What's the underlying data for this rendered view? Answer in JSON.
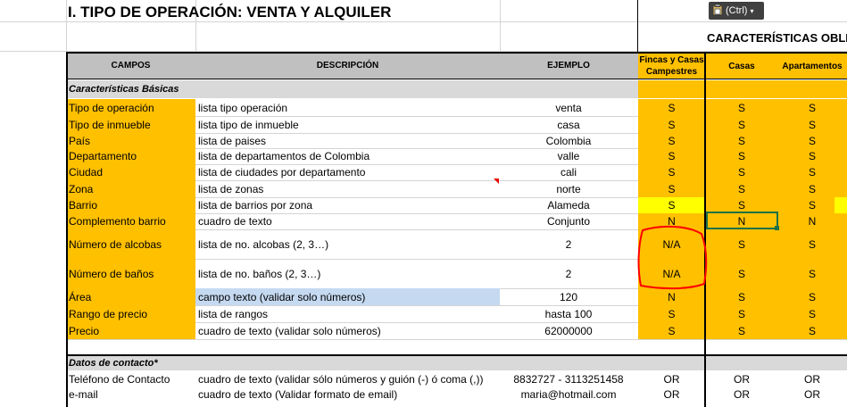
{
  "title": "I. TIPO DE OPERACIÓN: VENTA Y ALQUILER",
  "ctrl_label": "(Ctrl)",
  "caracteristicas_header": "CARACTERÍSTICAS OBLI",
  "headers": {
    "campos": "CAMPOS",
    "descripcion": "DESCRIPCIÓN",
    "ejemplo": "EJEMPLO",
    "fincas": [
      "Fincas y Casas",
      "Campestres"
    ],
    "casas": "Casas",
    "apartamentos": "Apartamentos"
  },
  "section_basic": "Características Básicas",
  "section_contact": "Datos de contacto*",
  "rows": [
    {
      "campo": "Tipo de operación",
      "desc": "lista tipo operación",
      "ejemplo": "venta",
      "fincas": "S",
      "casas": "S",
      "apto": "S"
    },
    {
      "campo": "Tipo de inmueble",
      "desc": "lista tipo de inmueble",
      "ejemplo": "casa",
      "fincas": "S",
      "casas": "S",
      "apto": "S"
    },
    {
      "campo": "País",
      "desc": "lista de paises",
      "ejemplo": "Colombia",
      "fincas": "S",
      "casas": "S",
      "apto": "S"
    },
    {
      "campo": "Departamento",
      "desc": "lista de departamentos de Colombia",
      "ejemplo": "valle",
      "fincas": "S",
      "casas": "S",
      "apto": "S"
    },
    {
      "campo": "Ciudad",
      "desc": "lista de ciudades por departamento",
      "ejemplo": "cali",
      "fincas": "S",
      "casas": "S",
      "apto": "S"
    },
    {
      "campo": "Zona",
      "desc": "lista de zonas",
      "ejemplo": "norte",
      "fincas": "S",
      "casas": "S",
      "apto": "S"
    },
    {
      "campo": "Barrio",
      "desc": "lista de barrios por zona",
      "ejemplo": "Alameda",
      "fincas": "S",
      "casas": "S",
      "apto": "S"
    },
    {
      "campo": "Complemento barrio",
      "desc": "cuadro de texto",
      "ejemplo": "Conjunto",
      "fincas": "N",
      "casas": "N",
      "apto": "N"
    },
    {
      "campo": "Número de alcobas",
      "desc": "lista de no. alcobas (2, 3…)",
      "ejemplo": "2",
      "fincas": "N/A",
      "casas": "S",
      "apto": "S"
    },
    {
      "campo": "Número de baños",
      "desc": "lista de no. baños (2, 3…)",
      "ejemplo": "2",
      "fincas": "N/A",
      "casas": "S",
      "apto": "S"
    },
    {
      "campo": "Área",
      "desc": "campo texto (validar solo números)",
      "ejemplo": "120",
      "fincas": "N",
      "casas": "S",
      "apto": "S"
    },
    {
      "campo": "Rango de precio",
      "desc": "lista de rangos",
      "ejemplo": "hasta 100",
      "fincas": "S",
      "casas": "S",
      "apto": "S"
    },
    {
      "campo": "Precio",
      "desc": "cuadro de texto (validar solo números)",
      "ejemplo": "62000000",
      "fincas": "S",
      "casas": "S",
      "apto": "S"
    }
  ],
  "contact_rows": [
    {
      "campo": "Teléfono de Contacto",
      "desc": "cuadro de texto (validar sólo números y guión (-) ó coma (,))",
      "ejemplo": "8832727 - 3113251458",
      "fincas": "OR",
      "casas": "OR",
      "apto": "OR"
    },
    {
      "campo": "e-mail",
      "desc": "cuadro de texto (Validar formato de email)",
      "ejemplo": "maria@hotmail.com",
      "fincas": "OR",
      "casas": "OR",
      "apto": "OR"
    }
  ],
  "colors": {
    "orange": "#ffc000",
    "yellow": "#ffff00",
    "blue": "#c5d9f1",
    "header_grey": "#c0c0c0",
    "annotation_red": "#ff0000"
  }
}
